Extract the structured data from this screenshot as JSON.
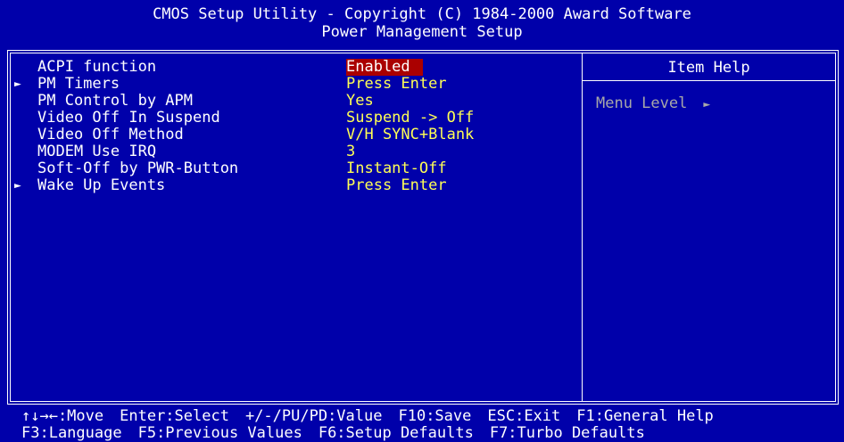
{
  "header": {
    "title": "CMOS Setup Utility - Copyright (C) 1984-2000 Award Software",
    "subtitle": "Power Management Setup"
  },
  "items": [
    {
      "label": "ACPI function",
      "value": "Enabled",
      "submenu": false,
      "selected": true
    },
    {
      "label": "PM Timers",
      "value": "Press Enter",
      "submenu": true,
      "selected": false
    },
    {
      "label": "PM Control by APM",
      "value": "Yes",
      "submenu": false,
      "selected": false
    },
    {
      "label": "Video Off In Suspend",
      "value": "Suspend -> Off",
      "submenu": false,
      "selected": false
    },
    {
      "label": "Video Off Method",
      "value": "V/H SYNC+Blank",
      "submenu": false,
      "selected": false
    },
    {
      "label": "MODEM Use IRQ",
      "value": "3",
      "submenu": false,
      "selected": false
    },
    {
      "label": "Soft-Off by PWR-Button",
      "value": "Instant-Off",
      "submenu": false,
      "selected": false
    },
    {
      "label": "Wake Up Events",
      "value": "Press Enter",
      "submenu": true,
      "selected": false
    }
  ],
  "help": {
    "title": "Item Help",
    "menu_level": "Menu Level",
    "menu_level_indicator": "►"
  },
  "footer": {
    "line1": [
      "↑↓→←:Move",
      "Enter:Select",
      "+/-/PU/PD:Value",
      "F10:Save",
      "ESC:Exit",
      "F1:General Help"
    ],
    "line2": [
      "F3:Language",
      "F5:Previous Values",
      "F6:Setup Defaults",
      "F7:Turbo Defaults"
    ]
  },
  "colors": {
    "background": "#0000aa",
    "text": "#ffffff",
    "value": "#ffff55",
    "highlight": "#aa0000",
    "dim": "#a8a8a8"
  }
}
